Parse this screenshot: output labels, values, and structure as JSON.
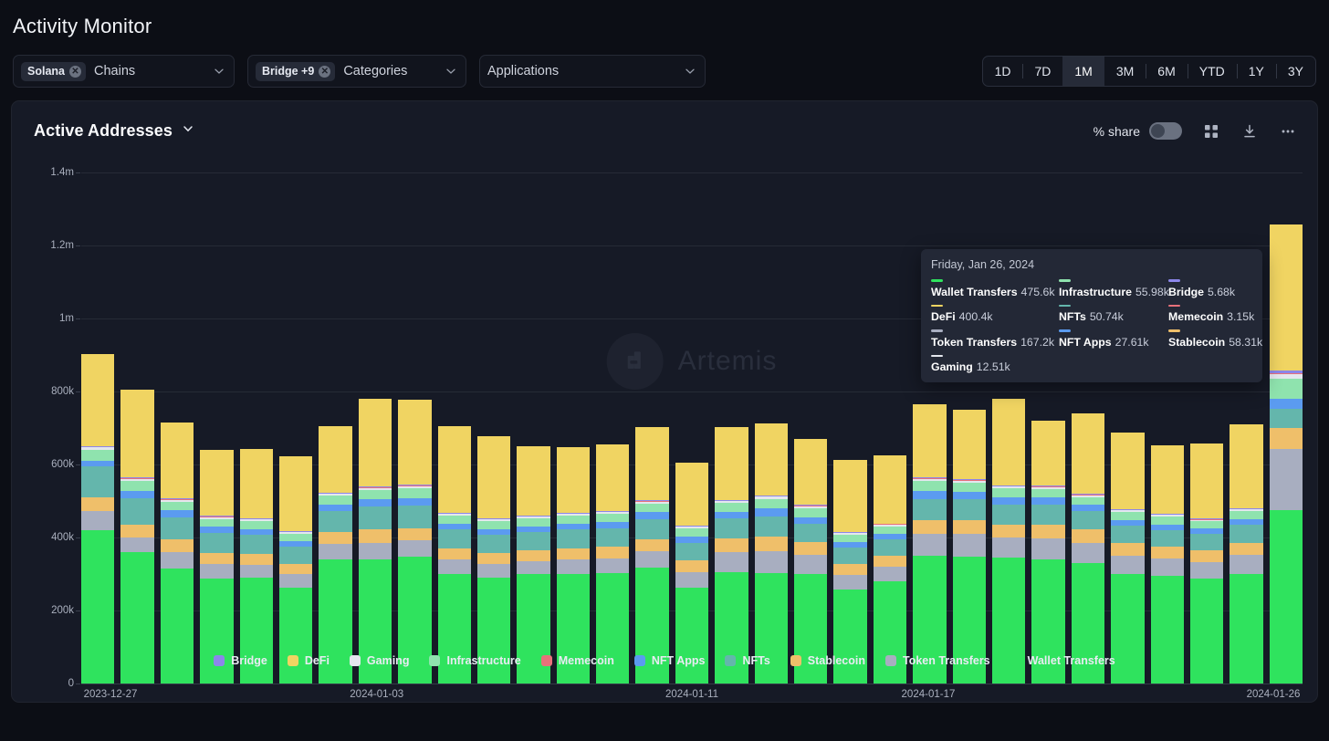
{
  "header": {
    "title": "Activity Monitor"
  },
  "filters": [
    {
      "name": "chains",
      "chip": "Solana",
      "placeholder": "Chains"
    },
    {
      "name": "categories",
      "chip": "Bridge +9",
      "placeholder": "Categories"
    },
    {
      "name": "applications",
      "chip": null,
      "placeholder": "Applications"
    }
  ],
  "time_ranges": {
    "options": [
      "1D",
      "7D",
      "1M",
      "3M",
      "6M",
      "YTD",
      "1Y",
      "3Y"
    ],
    "selected": "1M"
  },
  "card": {
    "metric_title": "Active Addresses",
    "share_label": "% share",
    "share_toggle_on": false,
    "actions": [
      "grid-icon",
      "download-icon",
      "more-icon"
    ],
    "watermark": "Artemis"
  },
  "tooltip": {
    "date": "Friday, Jan 26, 2024",
    "rows": [
      {
        "name": "Wallet Transfers",
        "value": "475.6k",
        "color": "#2fe35e"
      },
      {
        "name": "Infrastructure",
        "value": "55.98k",
        "color": "#8fe3ae"
      },
      {
        "name": "Bridge",
        "value": "5.68k",
        "color": "#8c86ea"
      },
      {
        "name": "DeFi",
        "value": "400.4k",
        "color": "#f0d462"
      },
      {
        "name": "NFTs",
        "value": "50.74k",
        "color": "#64b6ac"
      },
      {
        "name": "Memecoin",
        "value": "3.15k",
        "color": "#e8717a"
      },
      {
        "name": "Token Transfers",
        "value": "167.2k",
        "color": "#a8aec0"
      },
      {
        "name": "NFT Apps",
        "value": "27.61k",
        "color": "#5b9bf0"
      },
      {
        "name": "Stablecoin",
        "value": "58.31k",
        "color": "#efbf6a"
      },
      {
        "name": "Gaming",
        "value": "12.51k",
        "color": "#e4e7ee"
      }
    ]
  },
  "legend": [
    {
      "label": "Bridge",
      "color": "#8c86ea"
    },
    {
      "label": "DeFi",
      "color": "#f0d462"
    },
    {
      "label": "Gaming",
      "color": "#e4e7ee"
    },
    {
      "label": "Infrastructure",
      "color": "#8fe3ae"
    },
    {
      "label": "Memecoin",
      "color": "#e8717a"
    },
    {
      "label": "NFT Apps",
      "color": "#5b9bf0"
    },
    {
      "label": "NFTs",
      "color": "#64b6ac"
    },
    {
      "label": "Stablecoin",
      "color": "#efbf6a"
    },
    {
      "label": "Token Transfers",
      "color": "#a8aec0"
    },
    {
      "label": "Wallet Transfers",
      "color": "#2fe35e"
    }
  ],
  "chart_data": {
    "type": "bar",
    "title": "Active Addresses",
    "stacked": true,
    "xlabel": "",
    "ylabel": "",
    "ylim": [
      0,
      1400000
    ],
    "yticks": [
      0,
      200000,
      400000,
      600000,
      800000,
      1000000,
      1200000,
      1400000
    ],
    "ytick_labels": [
      "0",
      "200k",
      "400k",
      "600k",
      "800k",
      "1m",
      "1.2m",
      "1.4m"
    ],
    "grid": true,
    "legend_position": "bottom",
    "xtick_labels": [
      "2023-12-27",
      "2024-01-03",
      "2024-01-11",
      "2024-01-17",
      "2024-01-26"
    ],
    "xtick_indices": [
      0,
      7,
      15,
      21,
      30
    ],
    "categories": [
      "2023-12-27",
      "2023-12-28",
      "2023-12-29",
      "2023-12-30",
      "2023-12-31",
      "2024-01-01",
      "2024-01-02",
      "2024-01-03",
      "2024-01-04",
      "2024-01-05",
      "2024-01-06",
      "2024-01-07",
      "2024-01-08",
      "2024-01-09",
      "2024-01-10",
      "2024-01-11",
      "2024-01-12",
      "2024-01-13",
      "2024-01-14",
      "2024-01-15",
      "2024-01-16",
      "2024-01-17",
      "2024-01-18",
      "2024-01-19",
      "2024-01-20",
      "2024-01-21",
      "2024-01-22",
      "2024-01-23",
      "2024-01-24",
      "2024-01-25",
      "2024-01-26"
    ],
    "series": [
      {
        "name": "Wallet Transfers",
        "color": "#2fe35e",
        "values": [
          420000,
          360000,
          315000,
          288000,
          290000,
          262000,
          340000,
          340000,
          348000,
          300000,
          290000,
          300000,
          300000,
          302000,
          318000,
          262000,
          305000,
          302000,
          300000,
          258000,
          280000,
          350000,
          348000,
          345000,
          340000,
          330000,
          300000,
          295000,
          288000,
          300000,
          475600
        ]
      },
      {
        "name": "Token Transfers",
        "color": "#a8aec0",
        "values": [
          52000,
          40000,
          46000,
          40000,
          35000,
          38000,
          42000,
          46000,
          44000,
          40000,
          38000,
          36000,
          40000,
          40000,
          44000,
          42000,
          55000,
          60000,
          52000,
          40000,
          40000,
          60000,
          62000,
          55000,
          58000,
          56000,
          50000,
          48000,
          45000,
          52000,
          167200
        ]
      },
      {
        "name": "Stablecoin",
        "color": "#efbf6a",
        "values": [
          38000,
          36000,
          35000,
          30000,
          30000,
          28000,
          32000,
          36000,
          34000,
          30000,
          30000,
          28000,
          30000,
          32000,
          34000,
          34000,
          38000,
          40000,
          36000,
          30000,
          30000,
          38000,
          38000,
          36000,
          38000,
          36000,
          34000,
          32000,
          32000,
          34000,
          58310
        ]
      },
      {
        "name": "NFTs",
        "color": "#64b6ac",
        "values": [
          85000,
          72000,
          60000,
          55000,
          52000,
          48000,
          58000,
          62000,
          62000,
          52000,
          50000,
          50000,
          52000,
          52000,
          55000,
          48000,
          54000,
          56000,
          50000,
          45000,
          46000,
          58000,
          56000,
          55000,
          54000,
          50000,
          48000,
          46000,
          44000,
          48000,
          50740
        ]
      },
      {
        "name": "NFT Apps",
        "color": "#5b9bf0",
        "values": [
          16000,
          20000,
          18000,
          16000,
          16000,
          14000,
          18000,
          20000,
          20000,
          16000,
          15000,
          16000,
          16000,
          16000,
          18000,
          16000,
          18000,
          22000,
          18000,
          15000,
          15000,
          22000,
          20000,
          19000,
          19000,
          17000,
          16000,
          15000,
          15000,
          16000,
          27610
        ]
      },
      {
        "name": "Infrastructure",
        "color": "#8fe3ae",
        "values": [
          30000,
          26000,
          24000,
          22000,
          22000,
          20000,
          24000,
          26000,
          26000,
          22000,
          22000,
          22000,
          22000,
          22000,
          24000,
          22000,
          24000,
          26000,
          24000,
          20000,
          20000,
          26000,
          26000,
          24000,
          24000,
          22000,
          22000,
          21000,
          20000,
          22000,
          55980
        ]
      },
      {
        "name": "Gaming",
        "color": "#e4e7ee",
        "values": [
          6000,
          6000,
          5000,
          5000,
          5000,
          4500,
          5000,
          6000,
          6000,
          5000,
          5000,
          5000,
          5000,
          5000,
          5500,
          5000,
          5500,
          6000,
          5500,
          4500,
          4500,
          6000,
          6000,
          5500,
          5500,
          5000,
          5000,
          4800,
          4600,
          5000,
          12510
        ]
      },
      {
        "name": "Memecoin",
        "color": "#e8717a",
        "values": [
          1500,
          1500,
          1200,
          1200,
          1200,
          1000,
          1200,
          1500,
          1500,
          1200,
          1200,
          1200,
          1200,
          1200,
          1400,
          1200,
          1400,
          1500,
          1400,
          1100,
          1100,
          1500,
          1500,
          1400,
          1400,
          1300,
          1200,
          1200,
          1100,
          1200,
          3150
        ]
      },
      {
        "name": "Bridge",
        "color": "#8c86ea",
        "values": [
          2500,
          2500,
          2200,
          2000,
          2000,
          1800,
          2200,
          2500,
          2500,
          2000,
          2000,
          2000,
          2000,
          2000,
          2200,
          2000,
          2200,
          2500,
          2200,
          1800,
          1800,
          2500,
          2500,
          2300,
          2300,
          2100,
          2000,
          2000,
          1900,
          2000,
          5680
        ]
      },
      {
        "name": "DeFi",
        "color": "#f0d462",
        "values": [
          252000,
          240000,
          208000,
          180000,
          190000,
          206000,
          184000,
          240000,
          234000,
          237000,
          224000,
          190000,
          180000,
          182000,
          200000,
          172000,
          200000,
          196000,
          182000,
          196000,
          186000,
          202000,
          190000,
          238000,
          178000,
          220000,
          210000,
          188000,
          206000,
          230000,
          400400
        ]
      }
    ]
  }
}
